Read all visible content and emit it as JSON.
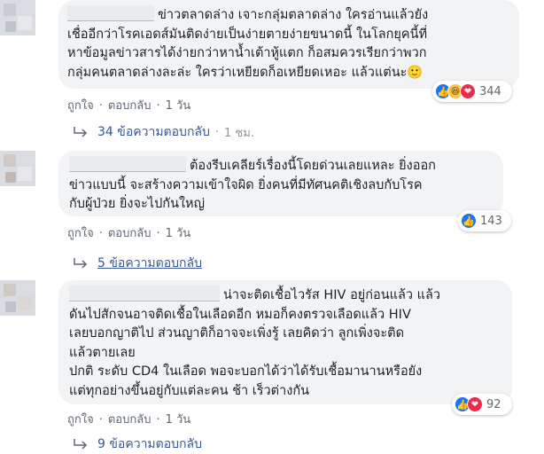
{
  "comments": [
    {
      "lines": [
        "ข่าวตลาดล่าง เจาะกลุ่มตลาดล่าง ใครอ่านแล้วยัง",
        "เชื่ออีกว่าโรคเอดส์มันติดง่ายเป็นง่ายตายง่ายขนาดนี้ ในโลกยุคนี้ที่",
        "หาข้อมูลข่าวสารได้ง่ายกว่าหาน้ำเต้าหู้แตก ก็อสมควรเรียกว่าพวก",
        "กลุ่มคนตลาดล่างละล่ะ ใครว่าเหยียดก็อเหยียดเหอะ แล้วแต่นะ🙂"
      ],
      "reaction_icons": [
        "like-icon",
        "haha-icon",
        "love-icon"
      ],
      "reaction_count": "344",
      "like": "ถูกใจ",
      "reply": "ตอบกลับ",
      "time": "1 วัน",
      "replies": "34 ข้อความตอบกลับ",
      "replies_time": "1 ชม."
    },
    {
      "lines": [
        "ต้องรีบเคลียร์เรื่องนี้โดยด่วนเลยแหละ ยิ่งออก",
        "ข่าวแบบนี้ จะสร้างความเข้าใจผิด ยิ่งคนที่มีทัศนคติเชิงลบกับโรค",
        "กับผู้ป่วย ยิ่งจะไปกันใหญ่"
      ],
      "reaction_icons": [
        "like-icon"
      ],
      "reaction_count": "143",
      "like": "ถูกใจ",
      "reply": "ตอบกลับ",
      "time": "1 วัน",
      "replies": "5 ข้อความตอบกลับ"
    },
    {
      "lines": [
        "น่าจะติดเชื้อไวรัส HIV อยู่ก่อนแล้ว แล้ว",
        "ดันไปสักจนอาจติดเชื้อในเลือดอีก หมอก็คงตรวจเลือดแล้ว HIV",
        "เลยบอกญาติไป ส่วนญาติก็อาจจะเพิ่งรู้ เลยคิดว่า ลูกเพิ่งจะติด",
        "แล้วตายเลย",
        "ปกติ ระดับ CD4 ในเลือด พอจะบอกได้ว่าได้รับเชื้อมานานหรือยัง",
        "แต่ทุกอย่างขึ้นอยู่กับแต่ละคน ช้า เร็วต่างกัน"
      ],
      "reaction_icons": [
        "like-icon",
        "love-icon"
      ],
      "reaction_count": "92",
      "like": "ถูกใจ",
      "reply": "ตอบกลับ",
      "time": "1 วัน",
      "replies": "9 ข้อความตอบกลับ"
    }
  ],
  "colors": {
    "link": "#385898",
    "bubble": "#f2f3f5",
    "like": "#1877f2",
    "love": "#f0284a",
    "haha": "#f7c54a"
  }
}
